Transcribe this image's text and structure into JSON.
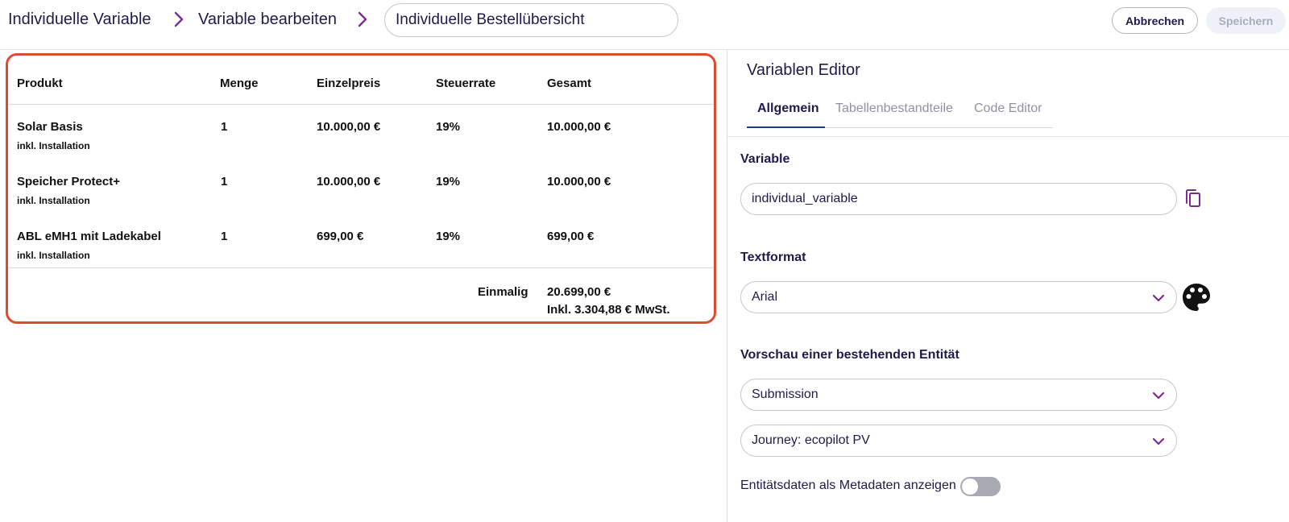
{
  "header": {
    "breadcrumb": [
      "Individuelle Variable",
      "Variable bearbeiten"
    ],
    "name_value": "Individuelle Bestellübersicht",
    "cancel_label": "Abbrechen",
    "save_label": "Speichern"
  },
  "preview": {
    "columns": [
      "Produkt",
      "Menge",
      "Einzelpreis",
      "Steuerrate",
      "Gesamt"
    ],
    "rows": [
      {
        "product": "Solar Basis",
        "note": "inkl. Installation",
        "quantity": "1",
        "unit_price": "10.000,00 €",
        "tax_rate": "19%",
        "total": "10.000,00 €"
      },
      {
        "product": "Speicher Protect+",
        "note": "inkl. Installation",
        "quantity": "1",
        "unit_price": "10.000,00 €",
        "tax_rate": "19%",
        "total": "10.000,00 €"
      },
      {
        "product": "ABL eMH1 mit Ladekabel",
        "note": "inkl. Installation",
        "quantity": "1",
        "unit_price": "699,00 €",
        "tax_rate": "19%",
        "total": "699,00 €"
      }
    ],
    "summary": {
      "label": "Einmalig",
      "total": "20.699,00 €",
      "tax_note": "Inkl. 3.304,88 € MwSt."
    },
    "highlight_color": "#dc4b34"
  },
  "editor": {
    "title": "Variablen Editor",
    "tabs": [
      {
        "label": "Allgemein",
        "active": true
      },
      {
        "label": "Tabellenbestandteile",
        "active": false
      },
      {
        "label": "Code Editor",
        "active": false
      }
    ],
    "variable": {
      "label": "Variable",
      "value": "individual_variable",
      "copy_icon": "copy-icon"
    },
    "textformat": {
      "label": "Textformat",
      "value": "Arial",
      "palette_icon": "palette-icon"
    },
    "preview_entity": {
      "label": "Vorschau einer bestehenden Entität",
      "entity_value": "Submission",
      "journey_value": "Journey: ecopilot PV"
    },
    "metadata_toggle": {
      "label": "Entitätsdaten als Metadaten anzeigen",
      "enabled": false
    },
    "accent_color": "#7b2d8e"
  }
}
